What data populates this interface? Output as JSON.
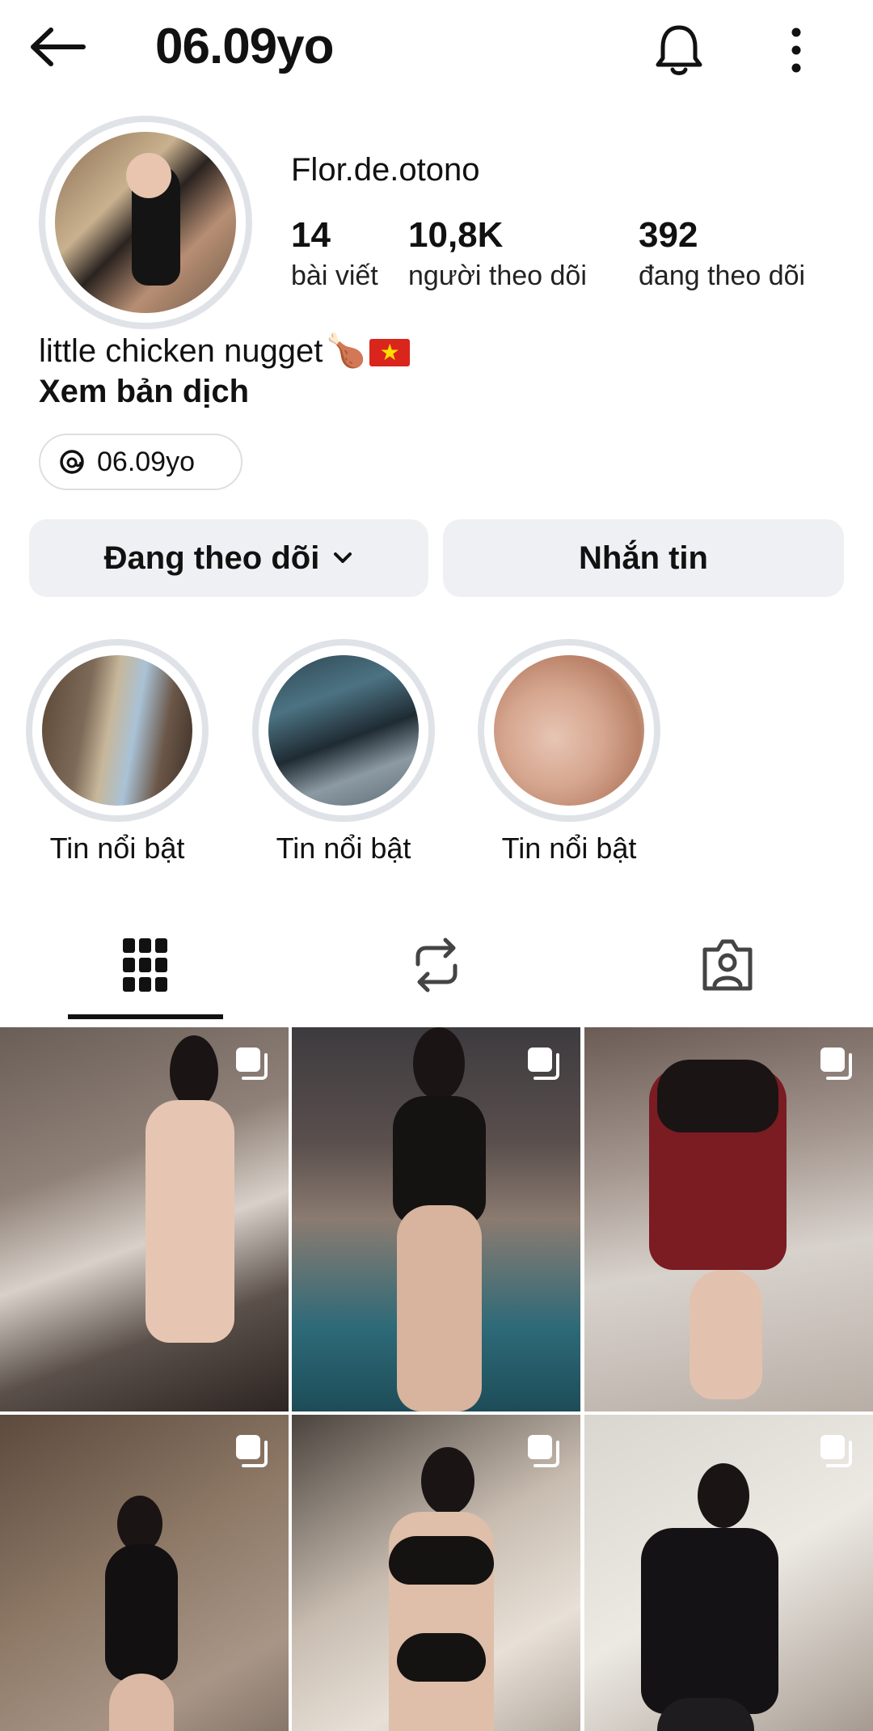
{
  "header": {
    "title": "06.09yo",
    "icons": {
      "back": "arrow-left-icon",
      "notifications": "bell-icon",
      "more": "more-vertical-icon"
    }
  },
  "profile": {
    "display_name": "Flor.de.otono",
    "stats": {
      "posts": {
        "value": "14",
        "label": "bài viết"
      },
      "followers": {
        "value": "10,8K",
        "label": "người theo dõi"
      },
      "following": {
        "value": "392",
        "label": "đang theo dõi"
      }
    },
    "bio": "little chicken nugget",
    "bio_emoji": "🍗",
    "translate_label": "Xem bản dịch",
    "threads_handle": "06.09yo"
  },
  "actions": {
    "following_label": "Đang theo dõi",
    "message_label": "Nhắn tin"
  },
  "highlights": [
    {
      "label": "Tin nổi bật"
    },
    {
      "label": "Tin nổi bật"
    },
    {
      "label": "Tin nổi bật"
    }
  ],
  "tabs": [
    {
      "name": "posts",
      "icon": "grid-icon",
      "active": true
    },
    {
      "name": "reposts",
      "icon": "repost-icon",
      "active": false
    },
    {
      "name": "tagged",
      "icon": "tagged-person-icon",
      "active": false
    }
  ],
  "grid": {
    "post_count_visible": 6,
    "multi_photo_icon": "carousel-icon"
  },
  "colors": {
    "button_bg": "#eff0f3",
    "ring": "#dfe3e8",
    "text": "#111111",
    "flag_red": "#da251d",
    "flag_star": "#ffde00"
  }
}
